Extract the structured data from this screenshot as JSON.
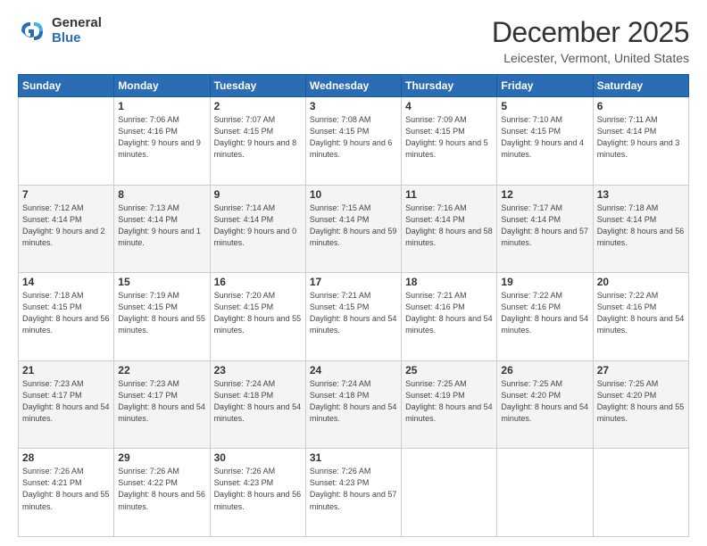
{
  "logo": {
    "general": "General",
    "blue": "Blue"
  },
  "title": "December 2025",
  "subtitle": "Leicester, Vermont, United States",
  "days_header": [
    "Sunday",
    "Monday",
    "Tuesday",
    "Wednesday",
    "Thursday",
    "Friday",
    "Saturday"
  ],
  "weeks": [
    [
      {
        "day": "",
        "sunrise": "",
        "sunset": "",
        "daylight": ""
      },
      {
        "day": "1",
        "sunrise": "Sunrise: 7:06 AM",
        "sunset": "Sunset: 4:16 PM",
        "daylight": "Daylight: 9 hours and 9 minutes."
      },
      {
        "day": "2",
        "sunrise": "Sunrise: 7:07 AM",
        "sunset": "Sunset: 4:15 PM",
        "daylight": "Daylight: 9 hours and 8 minutes."
      },
      {
        "day": "3",
        "sunrise": "Sunrise: 7:08 AM",
        "sunset": "Sunset: 4:15 PM",
        "daylight": "Daylight: 9 hours and 6 minutes."
      },
      {
        "day": "4",
        "sunrise": "Sunrise: 7:09 AM",
        "sunset": "Sunset: 4:15 PM",
        "daylight": "Daylight: 9 hours and 5 minutes."
      },
      {
        "day": "5",
        "sunrise": "Sunrise: 7:10 AM",
        "sunset": "Sunset: 4:15 PM",
        "daylight": "Daylight: 9 hours and 4 minutes."
      },
      {
        "day": "6",
        "sunrise": "Sunrise: 7:11 AM",
        "sunset": "Sunset: 4:14 PM",
        "daylight": "Daylight: 9 hours and 3 minutes."
      }
    ],
    [
      {
        "day": "7",
        "sunrise": "Sunrise: 7:12 AM",
        "sunset": "Sunset: 4:14 PM",
        "daylight": "Daylight: 9 hours and 2 minutes."
      },
      {
        "day": "8",
        "sunrise": "Sunrise: 7:13 AM",
        "sunset": "Sunset: 4:14 PM",
        "daylight": "Daylight: 9 hours and 1 minute."
      },
      {
        "day": "9",
        "sunrise": "Sunrise: 7:14 AM",
        "sunset": "Sunset: 4:14 PM",
        "daylight": "Daylight: 9 hours and 0 minutes."
      },
      {
        "day": "10",
        "sunrise": "Sunrise: 7:15 AM",
        "sunset": "Sunset: 4:14 PM",
        "daylight": "Daylight: 8 hours and 59 minutes."
      },
      {
        "day": "11",
        "sunrise": "Sunrise: 7:16 AM",
        "sunset": "Sunset: 4:14 PM",
        "daylight": "Daylight: 8 hours and 58 minutes."
      },
      {
        "day": "12",
        "sunrise": "Sunrise: 7:17 AM",
        "sunset": "Sunset: 4:14 PM",
        "daylight": "Daylight: 8 hours and 57 minutes."
      },
      {
        "day": "13",
        "sunrise": "Sunrise: 7:18 AM",
        "sunset": "Sunset: 4:14 PM",
        "daylight": "Daylight: 8 hours and 56 minutes."
      }
    ],
    [
      {
        "day": "14",
        "sunrise": "Sunrise: 7:18 AM",
        "sunset": "Sunset: 4:15 PM",
        "daylight": "Daylight: 8 hours and 56 minutes."
      },
      {
        "day": "15",
        "sunrise": "Sunrise: 7:19 AM",
        "sunset": "Sunset: 4:15 PM",
        "daylight": "Daylight: 8 hours and 55 minutes."
      },
      {
        "day": "16",
        "sunrise": "Sunrise: 7:20 AM",
        "sunset": "Sunset: 4:15 PM",
        "daylight": "Daylight: 8 hours and 55 minutes."
      },
      {
        "day": "17",
        "sunrise": "Sunrise: 7:21 AM",
        "sunset": "Sunset: 4:15 PM",
        "daylight": "Daylight: 8 hours and 54 minutes."
      },
      {
        "day": "18",
        "sunrise": "Sunrise: 7:21 AM",
        "sunset": "Sunset: 4:16 PM",
        "daylight": "Daylight: 8 hours and 54 minutes."
      },
      {
        "day": "19",
        "sunrise": "Sunrise: 7:22 AM",
        "sunset": "Sunset: 4:16 PM",
        "daylight": "Daylight: 8 hours and 54 minutes."
      },
      {
        "day": "20",
        "sunrise": "Sunrise: 7:22 AM",
        "sunset": "Sunset: 4:16 PM",
        "daylight": "Daylight: 8 hours and 54 minutes."
      }
    ],
    [
      {
        "day": "21",
        "sunrise": "Sunrise: 7:23 AM",
        "sunset": "Sunset: 4:17 PM",
        "daylight": "Daylight: 8 hours and 54 minutes."
      },
      {
        "day": "22",
        "sunrise": "Sunrise: 7:23 AM",
        "sunset": "Sunset: 4:17 PM",
        "daylight": "Daylight: 8 hours and 54 minutes."
      },
      {
        "day": "23",
        "sunrise": "Sunrise: 7:24 AM",
        "sunset": "Sunset: 4:18 PM",
        "daylight": "Daylight: 8 hours and 54 minutes."
      },
      {
        "day": "24",
        "sunrise": "Sunrise: 7:24 AM",
        "sunset": "Sunset: 4:18 PM",
        "daylight": "Daylight: 8 hours and 54 minutes."
      },
      {
        "day": "25",
        "sunrise": "Sunrise: 7:25 AM",
        "sunset": "Sunset: 4:19 PM",
        "daylight": "Daylight: 8 hours and 54 minutes."
      },
      {
        "day": "26",
        "sunrise": "Sunrise: 7:25 AM",
        "sunset": "Sunset: 4:20 PM",
        "daylight": "Daylight: 8 hours and 54 minutes."
      },
      {
        "day": "27",
        "sunrise": "Sunrise: 7:25 AM",
        "sunset": "Sunset: 4:20 PM",
        "daylight": "Daylight: 8 hours and 55 minutes."
      }
    ],
    [
      {
        "day": "28",
        "sunrise": "Sunrise: 7:26 AM",
        "sunset": "Sunset: 4:21 PM",
        "daylight": "Daylight: 8 hours and 55 minutes."
      },
      {
        "day": "29",
        "sunrise": "Sunrise: 7:26 AM",
        "sunset": "Sunset: 4:22 PM",
        "daylight": "Daylight: 8 hours and 56 minutes."
      },
      {
        "day": "30",
        "sunrise": "Sunrise: 7:26 AM",
        "sunset": "Sunset: 4:23 PM",
        "daylight": "Daylight: 8 hours and 56 minutes."
      },
      {
        "day": "31",
        "sunrise": "Sunrise: 7:26 AM",
        "sunset": "Sunset: 4:23 PM",
        "daylight": "Daylight: 8 hours and 57 minutes."
      },
      {
        "day": "",
        "sunrise": "",
        "sunset": "",
        "daylight": ""
      },
      {
        "day": "",
        "sunrise": "",
        "sunset": "",
        "daylight": ""
      },
      {
        "day": "",
        "sunrise": "",
        "sunset": "",
        "daylight": ""
      }
    ]
  ]
}
